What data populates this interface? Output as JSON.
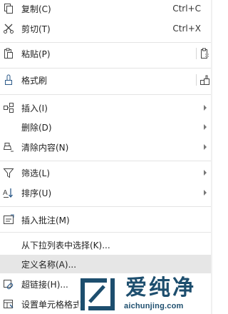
{
  "menu": {
    "copy": {
      "label": "复制(C)",
      "shortcut": "Ctrl+C",
      "icon": "copy-icon"
    },
    "cut": {
      "label": "剪切(T)",
      "shortcut": "Ctrl+X",
      "icon": "scissors-icon"
    },
    "paste": {
      "label": "粘贴(P)",
      "icon": "paste-icon"
    },
    "format_painter": {
      "label": "格式刷",
      "icon": "format-painter-icon"
    },
    "insert": {
      "label": "插入(I)",
      "icon": "insert-icon"
    },
    "delete": {
      "label": "删除(D)"
    },
    "clear_content": {
      "label": "清除内容(N)",
      "icon": "eraser-icon"
    },
    "filter": {
      "label": "筛选(L)",
      "icon": "filter-icon"
    },
    "sort": {
      "label": "排序(U)",
      "icon": "sort-icon"
    },
    "insert_comment": {
      "label": "插入批注(M)",
      "icon": "comment-icon"
    },
    "pick_from_list": {
      "label": "从下拉列表中选择(K)..."
    },
    "define_name": {
      "label": "定义名称(A)..."
    },
    "hyperlink": {
      "label": "超链接(H)...",
      "icon": "link-icon"
    },
    "format_cells": {
      "label": "设置单元格格式",
      "icon": "format-cells-icon"
    }
  },
  "watermark": {
    "title": "爱纯净",
    "url": "aichunjing.com"
  },
  "colors": {
    "highlight": "#e6e6e6",
    "watermark": "#1d4e6e"
  }
}
